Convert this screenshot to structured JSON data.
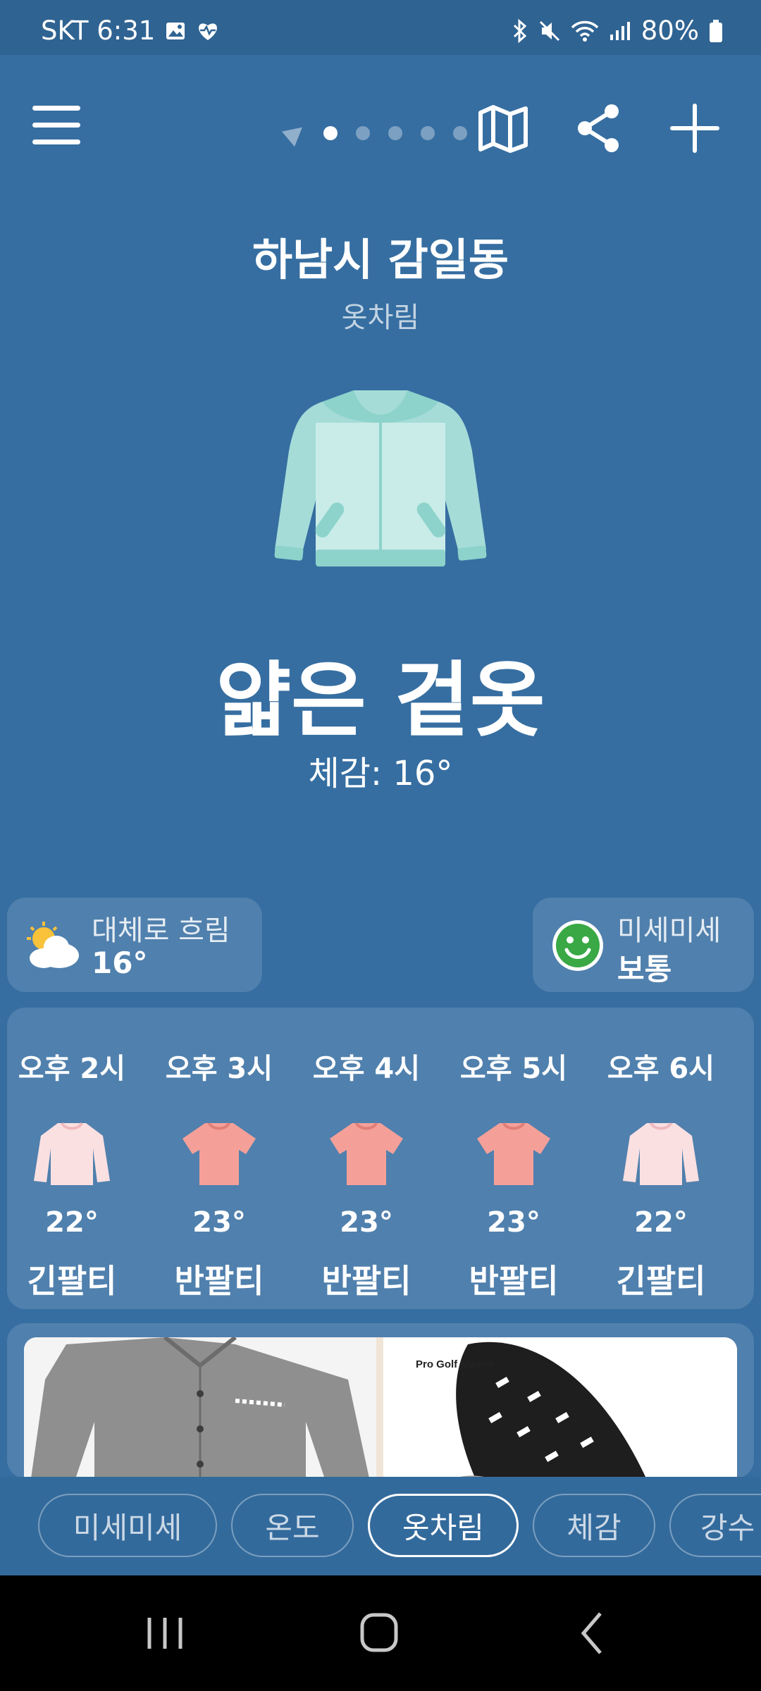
{
  "status": {
    "carrier_time": "SKT 6:31",
    "battery": "80%"
  },
  "header": {
    "city": "하남시 감일동",
    "subtitle": "옷차림"
  },
  "main": {
    "outfit": "얇은 겉옷",
    "feels_like": "체감: 16°"
  },
  "weather": {
    "condition": "대체로 흐림",
    "temp": "16°"
  },
  "dust": {
    "title": "미세미세",
    "status": "보통"
  },
  "hourly": [
    {
      "time": "오후 2시",
      "temp": "22°",
      "label": "긴팔티",
      "icon": "long-sleeve-shirt-icon"
    },
    {
      "time": "오후 3시",
      "temp": "23°",
      "label": "반팔티",
      "icon": "t-shirt-icon"
    },
    {
      "time": "오후 4시",
      "temp": "23°",
      "label": "반팔티",
      "icon": "t-shirt-icon"
    },
    {
      "time": "오후 5시",
      "temp": "23°",
      "label": "반팔티",
      "icon": "t-shirt-icon"
    },
    {
      "time": "오후 6시",
      "temp": "22°",
      "label": "긴팔티",
      "icon": "long-sleeve-shirt-icon"
    }
  ],
  "ad": {
    "brand_text": "Pro Golf Master"
  },
  "tabs": [
    {
      "label": "미세미세",
      "active": false
    },
    {
      "label": "온도",
      "active": false
    },
    {
      "label": "옷차림",
      "active": true
    },
    {
      "label": "체감",
      "active": false
    },
    {
      "label": "강수",
      "active": false
    }
  ],
  "colors": {
    "background": "#366ea1",
    "jacket": "#c9ece9",
    "jacket_trim": "#8dd3cc",
    "tshirt": "#f4a099",
    "long_sleeve": "#fbe0e2",
    "smiley": "#39a845"
  }
}
